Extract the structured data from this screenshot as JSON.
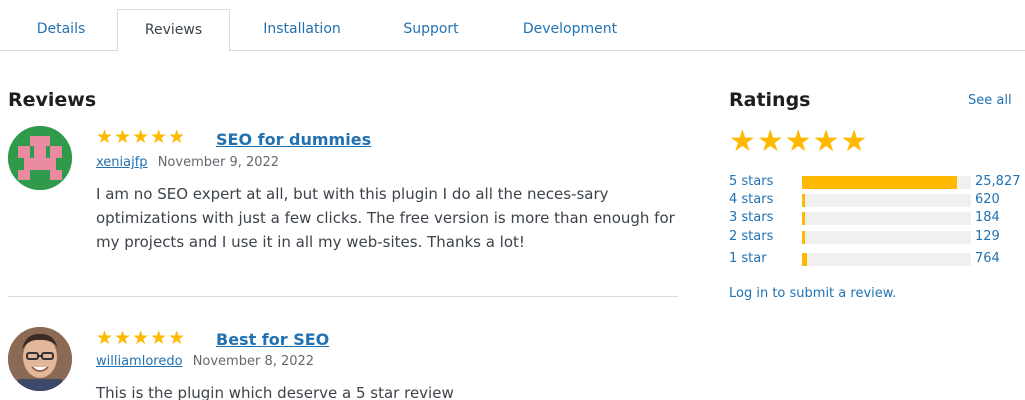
{
  "tabs": [
    {
      "label": "Details"
    },
    {
      "label": "Reviews"
    },
    {
      "label": "Installation"
    },
    {
      "label": "Support"
    },
    {
      "label": "Development"
    }
  ],
  "active_tab": "Reviews",
  "reviews_section": {
    "title": "Reviews",
    "items": [
      {
        "stars": "★★★★★",
        "rating": 5,
        "title": "SEO for dummies",
        "author": "xeniajfp",
        "date": "November 9, 2022",
        "body": "I am no SEO expert at all, but with this plugin I do all the neces-sary optimizations with just a few clicks. The free version is more than enough for my projects and I use it in all my web-sites. Thanks a lot!"
      },
      {
        "stars": "★★★★★",
        "rating": 5,
        "title": "Best for SEO",
        "author": "williamloredo",
        "date": "November 8, 2022",
        "body": "This is the plugin which deserve a 5 star review"
      }
    ]
  },
  "ratings": {
    "title": "Ratings",
    "see_all": "See all",
    "stars": "★★★★★",
    "rows": [
      {
        "label": "5 stars",
        "count": "25,827",
        "fraction": 0.92
      },
      {
        "label": "4 stars",
        "count": "620",
        "fraction": 0.02
      },
      {
        "label": "3 stars",
        "count": "184",
        "fraction": 0.01
      },
      {
        "label": "2 stars",
        "count": "129",
        "fraction": 0.01
      },
      {
        "label": "1 star",
        "count": "764",
        "fraction": 0.03
      }
    ],
    "login_link": "Log in to submit a review."
  },
  "colors": {
    "link": "#2271b1",
    "star": "#ffb900",
    "bar_bg": "#f0f0f1"
  }
}
